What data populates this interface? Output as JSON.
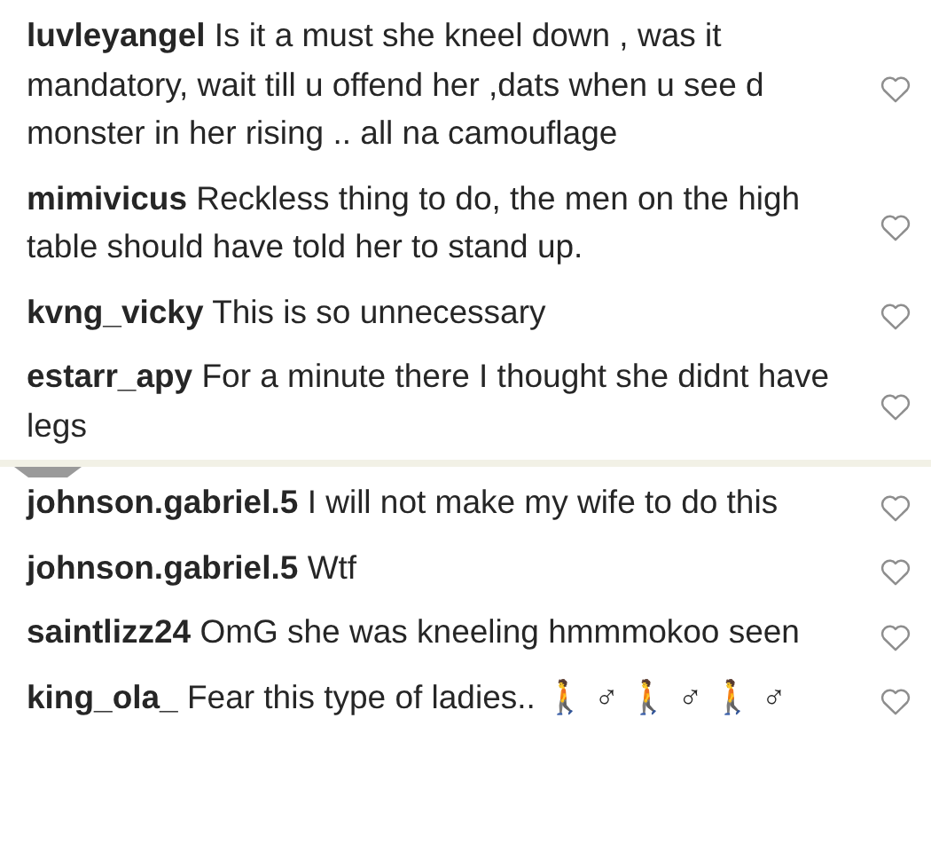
{
  "comments": [
    {
      "username": "luvleyangel",
      "text": "Is it a must she kneel down , was it mandatory, wait till u offend her ,dats when u see d monster in her rising .. all na camouflage",
      "liked": false
    },
    {
      "username": "mimivicus",
      "text": "Reckless thing to do, the men on the high table should have told her to stand up.",
      "liked": false
    },
    {
      "username": "kvng_vicky",
      "text": "This is so unnecessary",
      "liked": false
    },
    {
      "username": "estarr_apy",
      "text": "For a minute there I thought she didnt have legs",
      "liked": false
    },
    {
      "kind": "divider"
    },
    {
      "username": "johnson.gabriel.5",
      "text": "I will not make my wife to do this",
      "liked": false
    },
    {
      "username": "johnson.gabriel.5",
      "text": "Wtf",
      "liked": false
    },
    {
      "username": "saintlizz24",
      "text": "OmG she was kneeling hmmmokoo seen",
      "liked": false
    },
    {
      "username": "king_ola_",
      "text": "Fear this type of ladies.. 🚶 ♂ 🚶 ♂ 🚶 ♂",
      "liked": false
    }
  ]
}
